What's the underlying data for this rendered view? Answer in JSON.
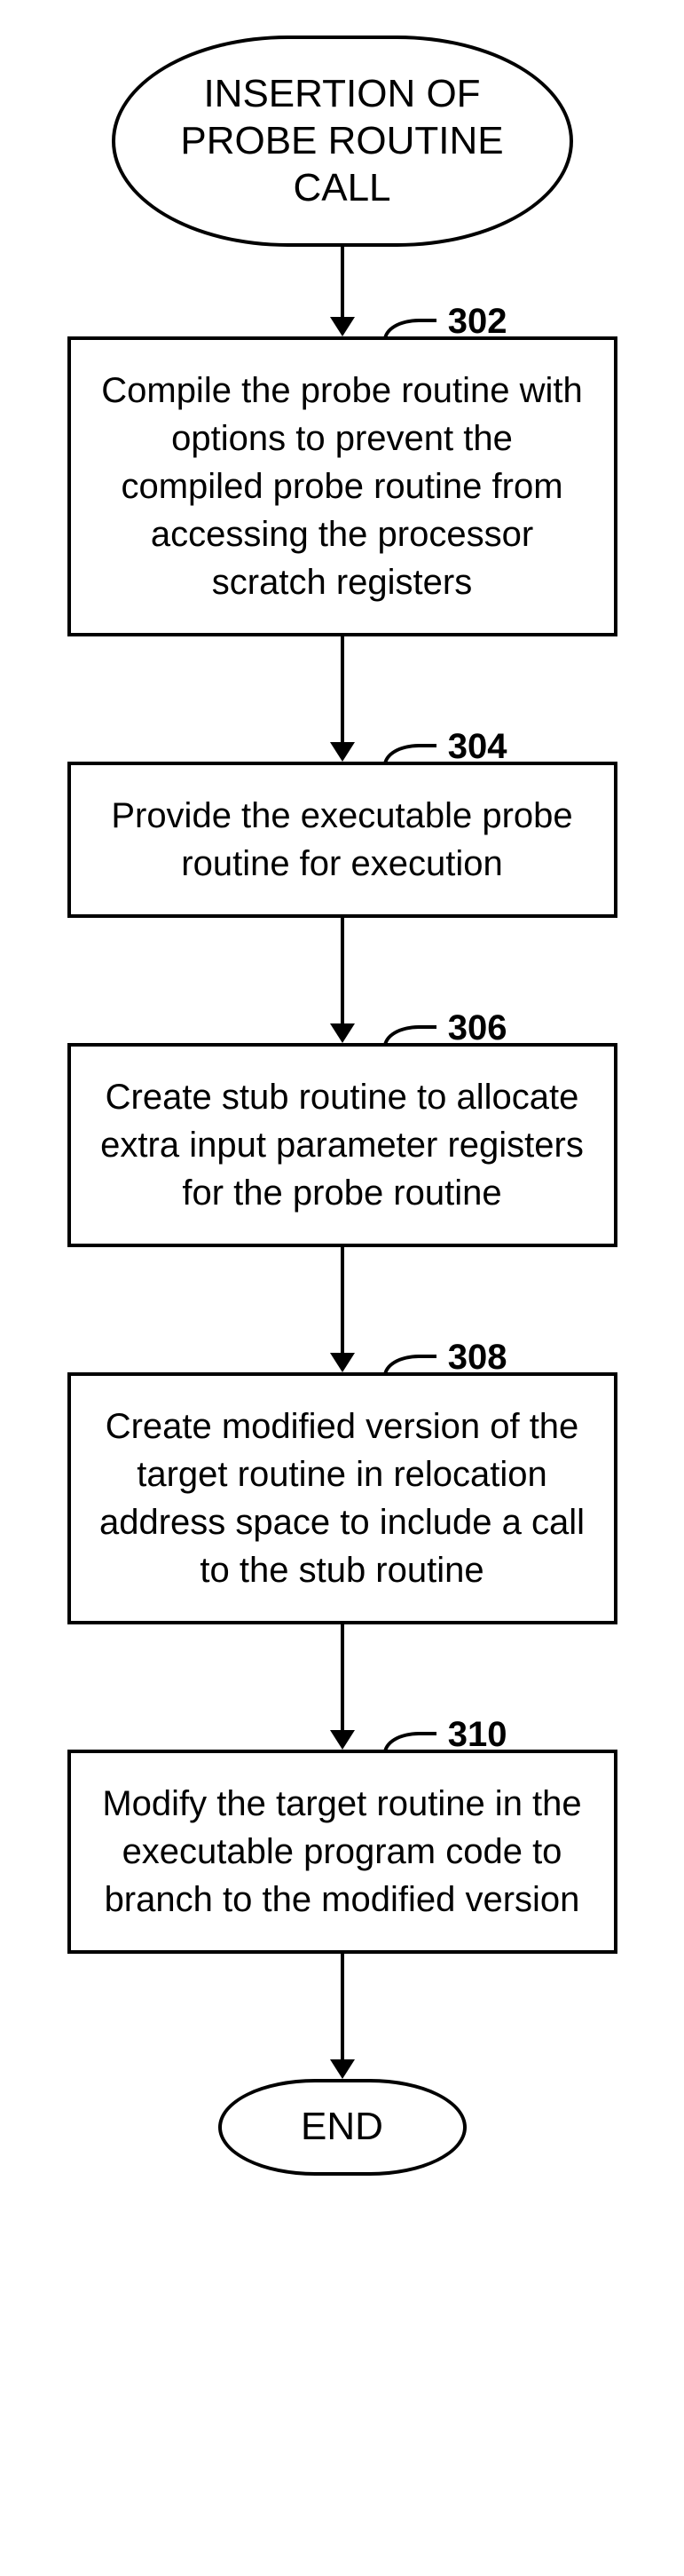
{
  "flowchart": {
    "start": "INSERTION OF PROBE ROUTINE CALL",
    "steps": [
      {
        "num": "302",
        "text": "Compile the probe routine with options to prevent the compiled probe routine from  accessing the processor scratch registers"
      },
      {
        "num": "304",
        "text": "Provide the executable probe routine for execution"
      },
      {
        "num": "306",
        "text": "Create stub routine to allocate extra input parameter registers for the probe routine"
      },
      {
        "num": "308",
        "text": "Create modified version of the target routine in relocation address space to include a call to the stub routine"
      },
      {
        "num": "310",
        "text": "Modify the target routine in the executable program code to branch to the modified version"
      }
    ],
    "end": "END"
  }
}
